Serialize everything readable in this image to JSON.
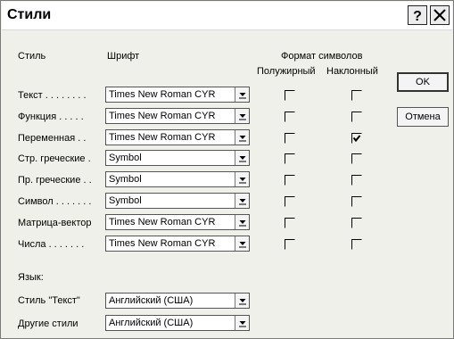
{
  "dialog": {
    "title": "Стили",
    "help_button": "?",
    "close_button": "×"
  },
  "headers": {
    "style": "Стиль",
    "font": "Шрифт",
    "format": "Формат символов",
    "bold": "Полужирный",
    "italic": "Наклонный"
  },
  "rows": [
    {
      "label": "Текст . . . . . . . .",
      "font": "Times New Roman CYR",
      "bold": false,
      "italic": false
    },
    {
      "label": "Функция . . . . .",
      "font": "Times New Roman CYR",
      "bold": false,
      "italic": false
    },
    {
      "label": "Переменная . .",
      "font": "Times New Roman CYR",
      "bold": false,
      "italic": true
    },
    {
      "label": "Стр. греческие .",
      "font": "Symbol",
      "bold": false,
      "italic": false
    },
    {
      "label": "Пр. греческие . .",
      "font": "Symbol",
      "bold": false,
      "italic": false
    },
    {
      "label": "Символ . . . . . . .",
      "font": "Symbol",
      "bold": false,
      "italic": false
    },
    {
      "label": "Матрица-вектор",
      "font": "Times New Roman CYR",
      "bold": false,
      "italic": false
    },
    {
      "label": "Числа . . . . . . .",
      "font": "Times New Roman CYR",
      "bold": false,
      "italic": false
    }
  ],
  "language": {
    "heading": "Язык:",
    "text_style_label": "Стиль \"Текст\"",
    "text_style_value": "Английский (США)",
    "other_styles_label": "Другие стили",
    "other_styles_value": "Английский (США)"
  },
  "buttons": {
    "ok": "OK",
    "cancel": "Отмена"
  }
}
